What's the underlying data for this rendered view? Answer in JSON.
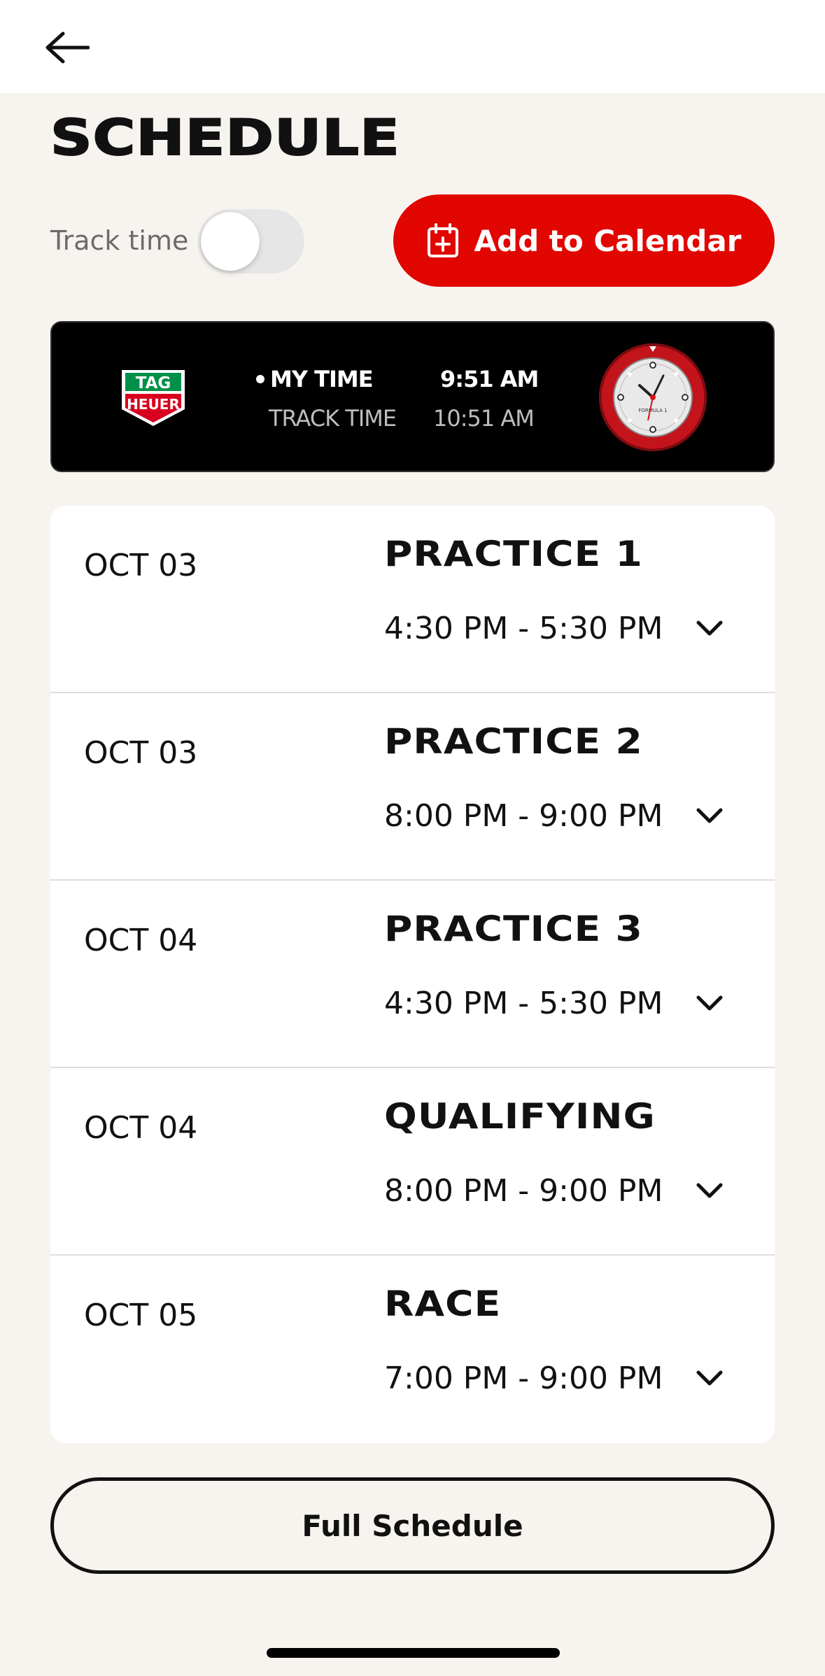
{
  "header": {
    "title": "SCHEDULE"
  },
  "controls": {
    "track_time_label": "Track time",
    "track_time_enabled": false,
    "add_to_calendar_label": "Add to Calendar"
  },
  "time_bar": {
    "brand": "TAG HEUER",
    "my_time_label": "MY TIME",
    "my_time_value": "9:51 AM",
    "track_time_label": "TRACK TIME",
    "track_time_value": "10:51 AM",
    "watch_label": "FORMULA 1"
  },
  "sessions": [
    {
      "date": "OCT 03",
      "name": "PRACTICE 1",
      "time": "4:30 PM - 5:30 PM"
    },
    {
      "date": "OCT 03",
      "name": "PRACTICE 2",
      "time": "8:00 PM - 9:00 PM"
    },
    {
      "date": "OCT 04",
      "name": "PRACTICE 3",
      "time": "4:30 PM - 5:30 PM"
    },
    {
      "date": "OCT 04",
      "name": "QUALIFYING",
      "time": "8:00 PM - 9:00 PM"
    },
    {
      "date": "OCT 05",
      "name": "RACE",
      "time": "7:00 PM - 9:00 PM"
    }
  ],
  "footer": {
    "full_schedule_label": "Full Schedule"
  },
  "colors": {
    "accent": "#e10600",
    "background": "#f7f4f0",
    "card": "#ffffff",
    "bar": "#000000"
  }
}
